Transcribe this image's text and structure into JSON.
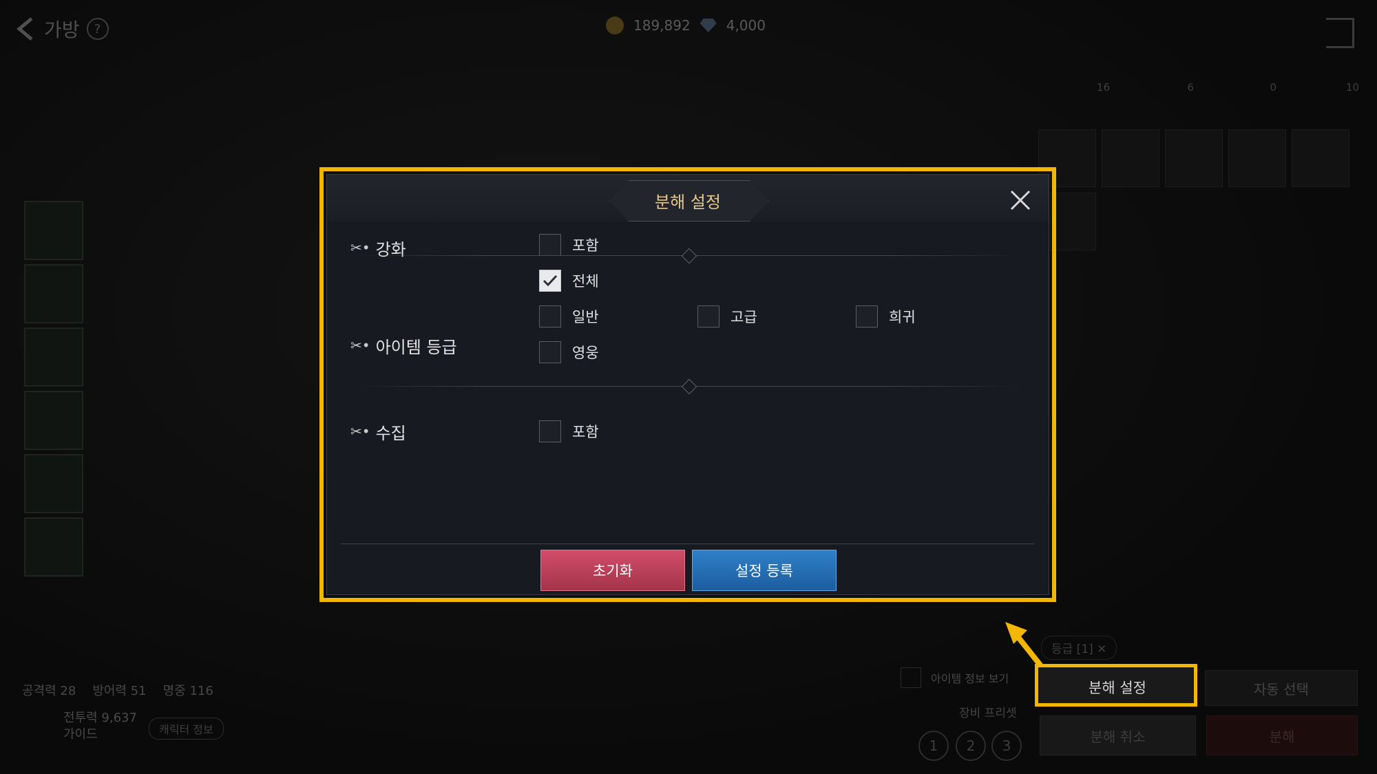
{
  "header": {
    "back_label": "가방",
    "help": "?",
    "gold": "189,892",
    "gems": "4,000"
  },
  "inventory_tabs": [
    {
      "label": "16"
    },
    {
      "label": "6"
    },
    {
      "label": "0"
    },
    {
      "label": "10"
    }
  ],
  "character": {
    "attack": "공격력 28",
    "defense": "방어력 51",
    "accuracy": "명중 116",
    "power": "전투력 9,637",
    "guide": "가이드",
    "info_button": "캐릭터 정보"
  },
  "filter_chip": "등급 [1]",
  "item_info_toggle": "아이템 정보 보기",
  "preset": {
    "label": "장비 프리셋",
    "options": [
      "1",
      "2",
      "3"
    ]
  },
  "actions": {
    "settings": "분해 설정",
    "auto_select": "자동 선택",
    "cancel": "분해 취소",
    "disassemble": "분해"
  },
  "modal": {
    "title": "분해 설정",
    "rows": {
      "enhance": {
        "label": "강화",
        "options": [
          {
            "label": "포함",
            "checked": false
          }
        ]
      },
      "grade": {
        "label": "아이템 등급",
        "options": [
          {
            "label": "전체",
            "checked": true
          },
          {
            "label": "일반",
            "checked": false
          },
          {
            "label": "고급",
            "checked": false
          },
          {
            "label": "희귀",
            "checked": false
          },
          {
            "label": "영웅",
            "checked": false
          }
        ]
      },
      "collection": {
        "label": "수집",
        "options": [
          {
            "label": "포함",
            "checked": false
          }
        ]
      }
    },
    "buttons": {
      "reset": "초기화",
      "register": "설정 등록"
    }
  },
  "colors": {
    "highlight": "#f2b705",
    "title_gold": "#e7c98f",
    "reset": "#c0425c",
    "register": "#2a72b8"
  }
}
